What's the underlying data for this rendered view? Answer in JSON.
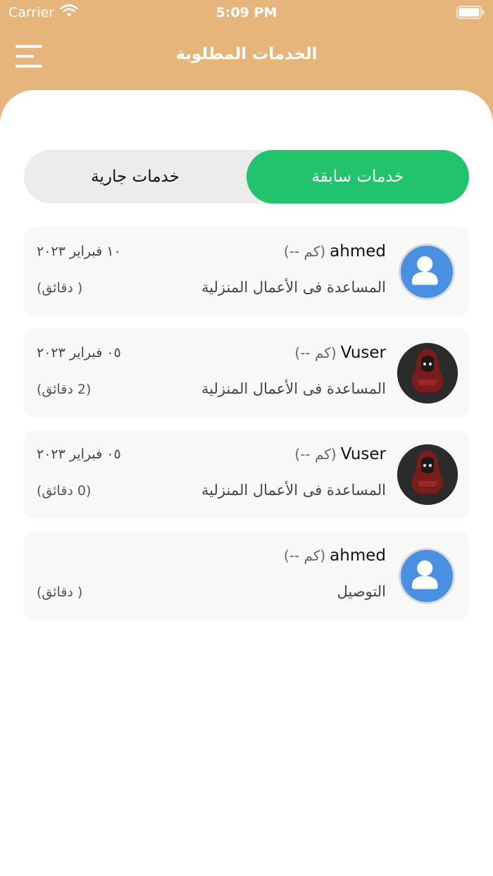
{
  "status_bar": {
    "carrier": "Carrier",
    "time": "5:09 PM"
  },
  "header": {
    "title": "الخدمات المطلوبة",
    "menu_icon": "hamburger-menu-icon"
  },
  "tabs": {
    "previous_label": "خدمات سابقة",
    "current_label": "خدمات جارية",
    "selected": "previous",
    "selected_color": "#22c36d"
  },
  "services": [
    {
      "name": "ahmed",
      "distance": "(-- كم)",
      "service": "المساعدة فى الأعمال المنزلية",
      "date": "١٠ فبراير ٢٠٢٣",
      "duration": "( دقائق)",
      "avatar": "default-user-icon"
    },
    {
      "name": "Vuser",
      "distance": "(-- كم)",
      "service": "المساعدة فى الأعمال المنزلية",
      "date": "٠٥ فبراير ٢٠٢٣",
      "duration": "(2 دقائق)",
      "avatar": "profile-photo"
    },
    {
      "name": "Vuser",
      "distance": "(-- كم)",
      "service": "المساعدة فى الأعمال المنزلية",
      "date": "٠٥ فبراير ٢٠٢٣",
      "duration": "(0 دقائق)",
      "avatar": "profile-photo"
    },
    {
      "name": "ahmed",
      "distance": "(-- كم)",
      "service": "التوصيل",
      "date": "",
      "duration": "( دقائق)",
      "avatar": "default-user-icon"
    }
  ],
  "colors": {
    "header_bg": "#e6b57c",
    "accent": "#22c36d"
  }
}
